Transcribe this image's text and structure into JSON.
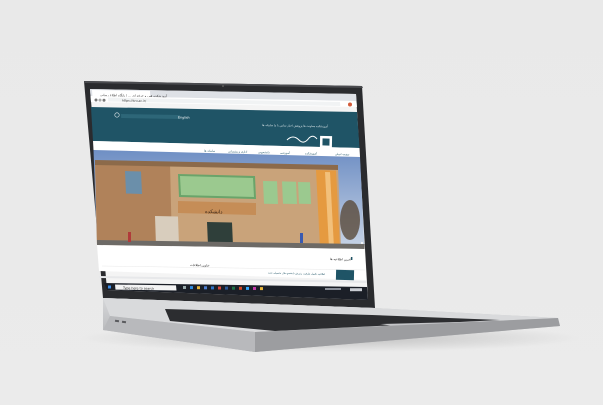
{
  "browser": {
    "tab_title": "آموزشکده فنی و حرفه ای ... | پایگاه اطلاع رسانی",
    "url": "https://tvu.ac.ir/"
  },
  "site": {
    "search_lang": "English",
    "top_links": "آموزشکده   معاونت ها   پژوهش   اخبار   تماس با ما   سامانه ها",
    "menu": [
      "صفحه اصلی",
      "آموزشکده",
      "آموزشی",
      "دانشجویی",
      "اداری و پشتیبانی",
      "سامانه ها",
      "ارتباط با ما"
    ],
    "building_sign": "دانشکده",
    "news_heading": "آخرین اطلاعیه ها",
    "notices_heading": "عناوین اطلاعات",
    "news_item": "اطلاعیه تکمیل ظرفیت پذیرش دانشجو سال تحصیلی جدید"
  },
  "taskbar": {
    "search_placeholder": "Type here to search"
  },
  "colors": {
    "site_header": "#1f5466",
    "taskbar": "#1b1f27",
    "laptop_body": "#c9cacc"
  }
}
